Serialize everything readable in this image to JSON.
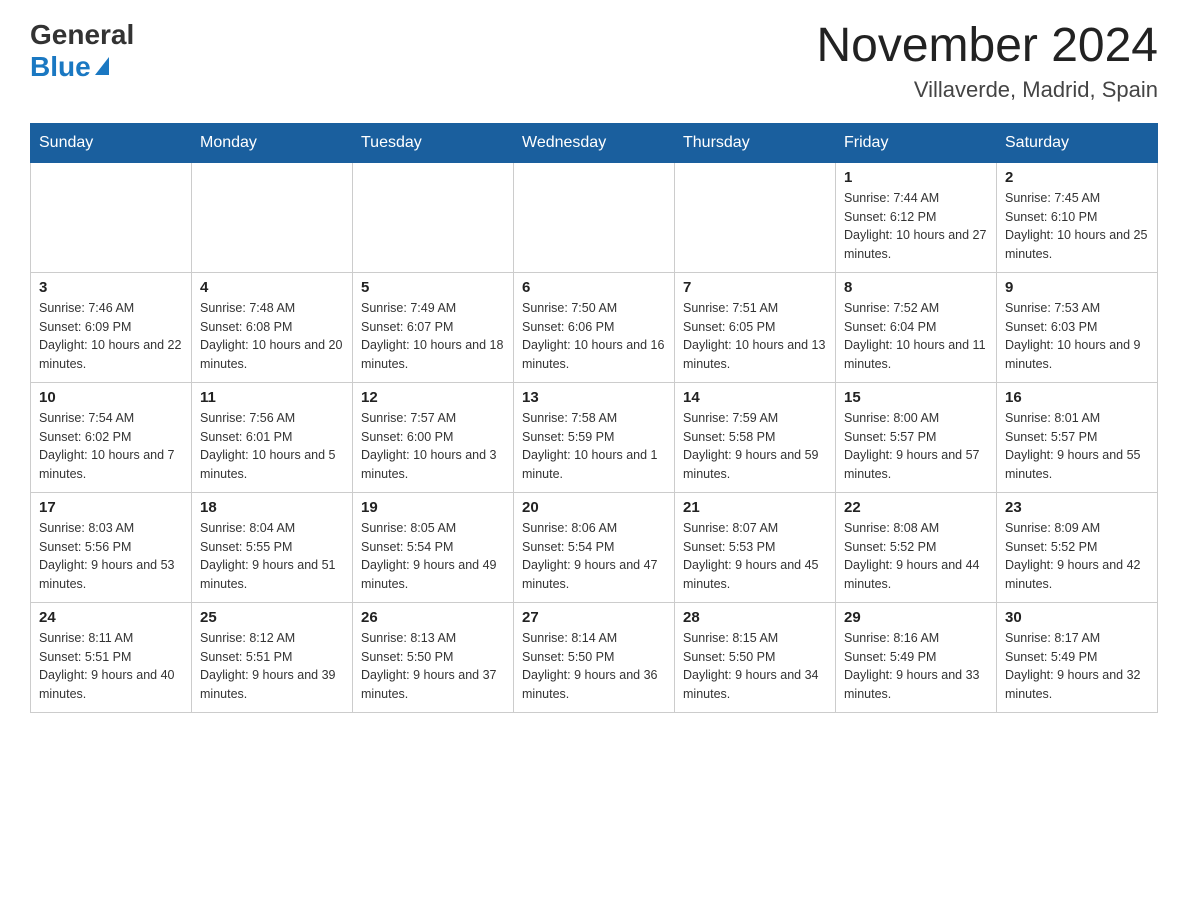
{
  "header": {
    "logo_general": "General",
    "logo_blue": "Blue",
    "month_year": "November 2024",
    "location": "Villaverde, Madrid, Spain"
  },
  "weekdays": [
    "Sunday",
    "Monday",
    "Tuesday",
    "Wednesday",
    "Thursday",
    "Friday",
    "Saturday"
  ],
  "weeks": [
    [
      {
        "day": "",
        "info": ""
      },
      {
        "day": "",
        "info": ""
      },
      {
        "day": "",
        "info": ""
      },
      {
        "day": "",
        "info": ""
      },
      {
        "day": "",
        "info": ""
      },
      {
        "day": "1",
        "info": "Sunrise: 7:44 AM\nSunset: 6:12 PM\nDaylight: 10 hours and 27 minutes."
      },
      {
        "day": "2",
        "info": "Sunrise: 7:45 AM\nSunset: 6:10 PM\nDaylight: 10 hours and 25 minutes."
      }
    ],
    [
      {
        "day": "3",
        "info": "Sunrise: 7:46 AM\nSunset: 6:09 PM\nDaylight: 10 hours and 22 minutes."
      },
      {
        "day": "4",
        "info": "Sunrise: 7:48 AM\nSunset: 6:08 PM\nDaylight: 10 hours and 20 minutes."
      },
      {
        "day": "5",
        "info": "Sunrise: 7:49 AM\nSunset: 6:07 PM\nDaylight: 10 hours and 18 minutes."
      },
      {
        "day": "6",
        "info": "Sunrise: 7:50 AM\nSunset: 6:06 PM\nDaylight: 10 hours and 16 minutes."
      },
      {
        "day": "7",
        "info": "Sunrise: 7:51 AM\nSunset: 6:05 PM\nDaylight: 10 hours and 13 minutes."
      },
      {
        "day": "8",
        "info": "Sunrise: 7:52 AM\nSunset: 6:04 PM\nDaylight: 10 hours and 11 minutes."
      },
      {
        "day": "9",
        "info": "Sunrise: 7:53 AM\nSunset: 6:03 PM\nDaylight: 10 hours and 9 minutes."
      }
    ],
    [
      {
        "day": "10",
        "info": "Sunrise: 7:54 AM\nSunset: 6:02 PM\nDaylight: 10 hours and 7 minutes."
      },
      {
        "day": "11",
        "info": "Sunrise: 7:56 AM\nSunset: 6:01 PM\nDaylight: 10 hours and 5 minutes."
      },
      {
        "day": "12",
        "info": "Sunrise: 7:57 AM\nSunset: 6:00 PM\nDaylight: 10 hours and 3 minutes."
      },
      {
        "day": "13",
        "info": "Sunrise: 7:58 AM\nSunset: 5:59 PM\nDaylight: 10 hours and 1 minute."
      },
      {
        "day": "14",
        "info": "Sunrise: 7:59 AM\nSunset: 5:58 PM\nDaylight: 9 hours and 59 minutes."
      },
      {
        "day": "15",
        "info": "Sunrise: 8:00 AM\nSunset: 5:57 PM\nDaylight: 9 hours and 57 minutes."
      },
      {
        "day": "16",
        "info": "Sunrise: 8:01 AM\nSunset: 5:57 PM\nDaylight: 9 hours and 55 minutes."
      }
    ],
    [
      {
        "day": "17",
        "info": "Sunrise: 8:03 AM\nSunset: 5:56 PM\nDaylight: 9 hours and 53 minutes."
      },
      {
        "day": "18",
        "info": "Sunrise: 8:04 AM\nSunset: 5:55 PM\nDaylight: 9 hours and 51 minutes."
      },
      {
        "day": "19",
        "info": "Sunrise: 8:05 AM\nSunset: 5:54 PM\nDaylight: 9 hours and 49 minutes."
      },
      {
        "day": "20",
        "info": "Sunrise: 8:06 AM\nSunset: 5:54 PM\nDaylight: 9 hours and 47 minutes."
      },
      {
        "day": "21",
        "info": "Sunrise: 8:07 AM\nSunset: 5:53 PM\nDaylight: 9 hours and 45 minutes."
      },
      {
        "day": "22",
        "info": "Sunrise: 8:08 AM\nSunset: 5:52 PM\nDaylight: 9 hours and 44 minutes."
      },
      {
        "day": "23",
        "info": "Sunrise: 8:09 AM\nSunset: 5:52 PM\nDaylight: 9 hours and 42 minutes."
      }
    ],
    [
      {
        "day": "24",
        "info": "Sunrise: 8:11 AM\nSunset: 5:51 PM\nDaylight: 9 hours and 40 minutes."
      },
      {
        "day": "25",
        "info": "Sunrise: 8:12 AM\nSunset: 5:51 PM\nDaylight: 9 hours and 39 minutes."
      },
      {
        "day": "26",
        "info": "Sunrise: 8:13 AM\nSunset: 5:50 PM\nDaylight: 9 hours and 37 minutes."
      },
      {
        "day": "27",
        "info": "Sunrise: 8:14 AM\nSunset: 5:50 PM\nDaylight: 9 hours and 36 minutes."
      },
      {
        "day": "28",
        "info": "Sunrise: 8:15 AM\nSunset: 5:50 PM\nDaylight: 9 hours and 34 minutes."
      },
      {
        "day": "29",
        "info": "Sunrise: 8:16 AM\nSunset: 5:49 PM\nDaylight: 9 hours and 33 minutes."
      },
      {
        "day": "30",
        "info": "Sunrise: 8:17 AM\nSunset: 5:49 PM\nDaylight: 9 hours and 32 minutes."
      }
    ]
  ]
}
